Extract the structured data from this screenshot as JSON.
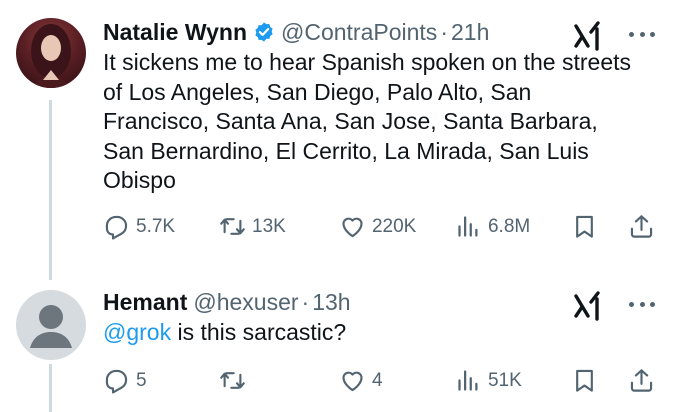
{
  "tweets": [
    {
      "author": "Natalie Wynn",
      "handle": "@ContraPoints",
      "separator": "·",
      "time": "21h",
      "body": "It sickens me to hear Spanish spoken on the streets of Los Angeles, San Diego, Palo Alto, San Francisco, Santa Ana, San Jose, Santa Barbara, San Bernardino, El Cerrito, La Mirada, San Luis Obispo",
      "replies": "5.7K",
      "reposts": "13K",
      "likes": "220K",
      "views": "6.8M"
    },
    {
      "author": "Hemant",
      "handle": "@hexuser",
      "separator": "·",
      "time": "13h",
      "mention": "@grok",
      "body_rest": " is this sarcastic?",
      "replies": "5",
      "reposts": "",
      "likes": "4",
      "views": "51K"
    }
  ],
  "colors": {
    "text": "#0f1419",
    "secondary": "#536471",
    "link": "#1d9bf0",
    "thread_line": "#cfd9de"
  },
  "icons": [
    "verified-badge-icon",
    "grok-icon",
    "more-icon",
    "reply-icon",
    "repost-icon",
    "like-icon",
    "views-icon",
    "bookmark-icon",
    "share-icon"
  ]
}
